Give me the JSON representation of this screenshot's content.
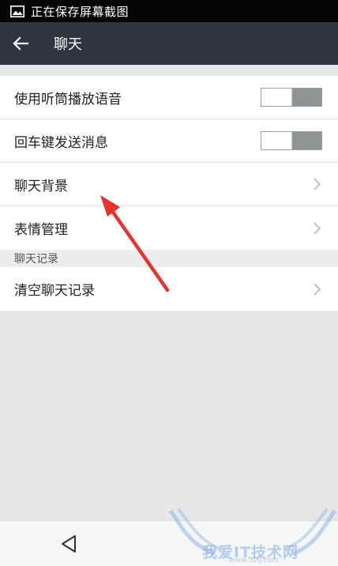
{
  "status_bar": {
    "icon": "image-icon",
    "text": "正在保存屏幕截图"
  },
  "action_bar": {
    "back_icon": "arrow-left-icon",
    "title": "聊天"
  },
  "settings": {
    "items": [
      {
        "label": "使用听筒播放语音",
        "control": "toggle",
        "state": "off"
      },
      {
        "label": "回车键发送消息",
        "control": "toggle",
        "state": "off"
      },
      {
        "label": "聊天背景",
        "control": "chevron"
      },
      {
        "label": "表情管理",
        "control": "chevron"
      }
    ]
  },
  "records": {
    "header": "聊天记录",
    "items": [
      {
        "label": "清空聊天记录",
        "control": "chevron"
      }
    ]
  },
  "nav_bar": {
    "back_icon": "triangle-back-icon"
  },
  "watermark": {
    "text": "我爱IT技术网",
    "sub": "www.52ij.com"
  },
  "colors": {
    "action_bar": "#2e3440",
    "annotation_arrow": "#e8322c"
  }
}
